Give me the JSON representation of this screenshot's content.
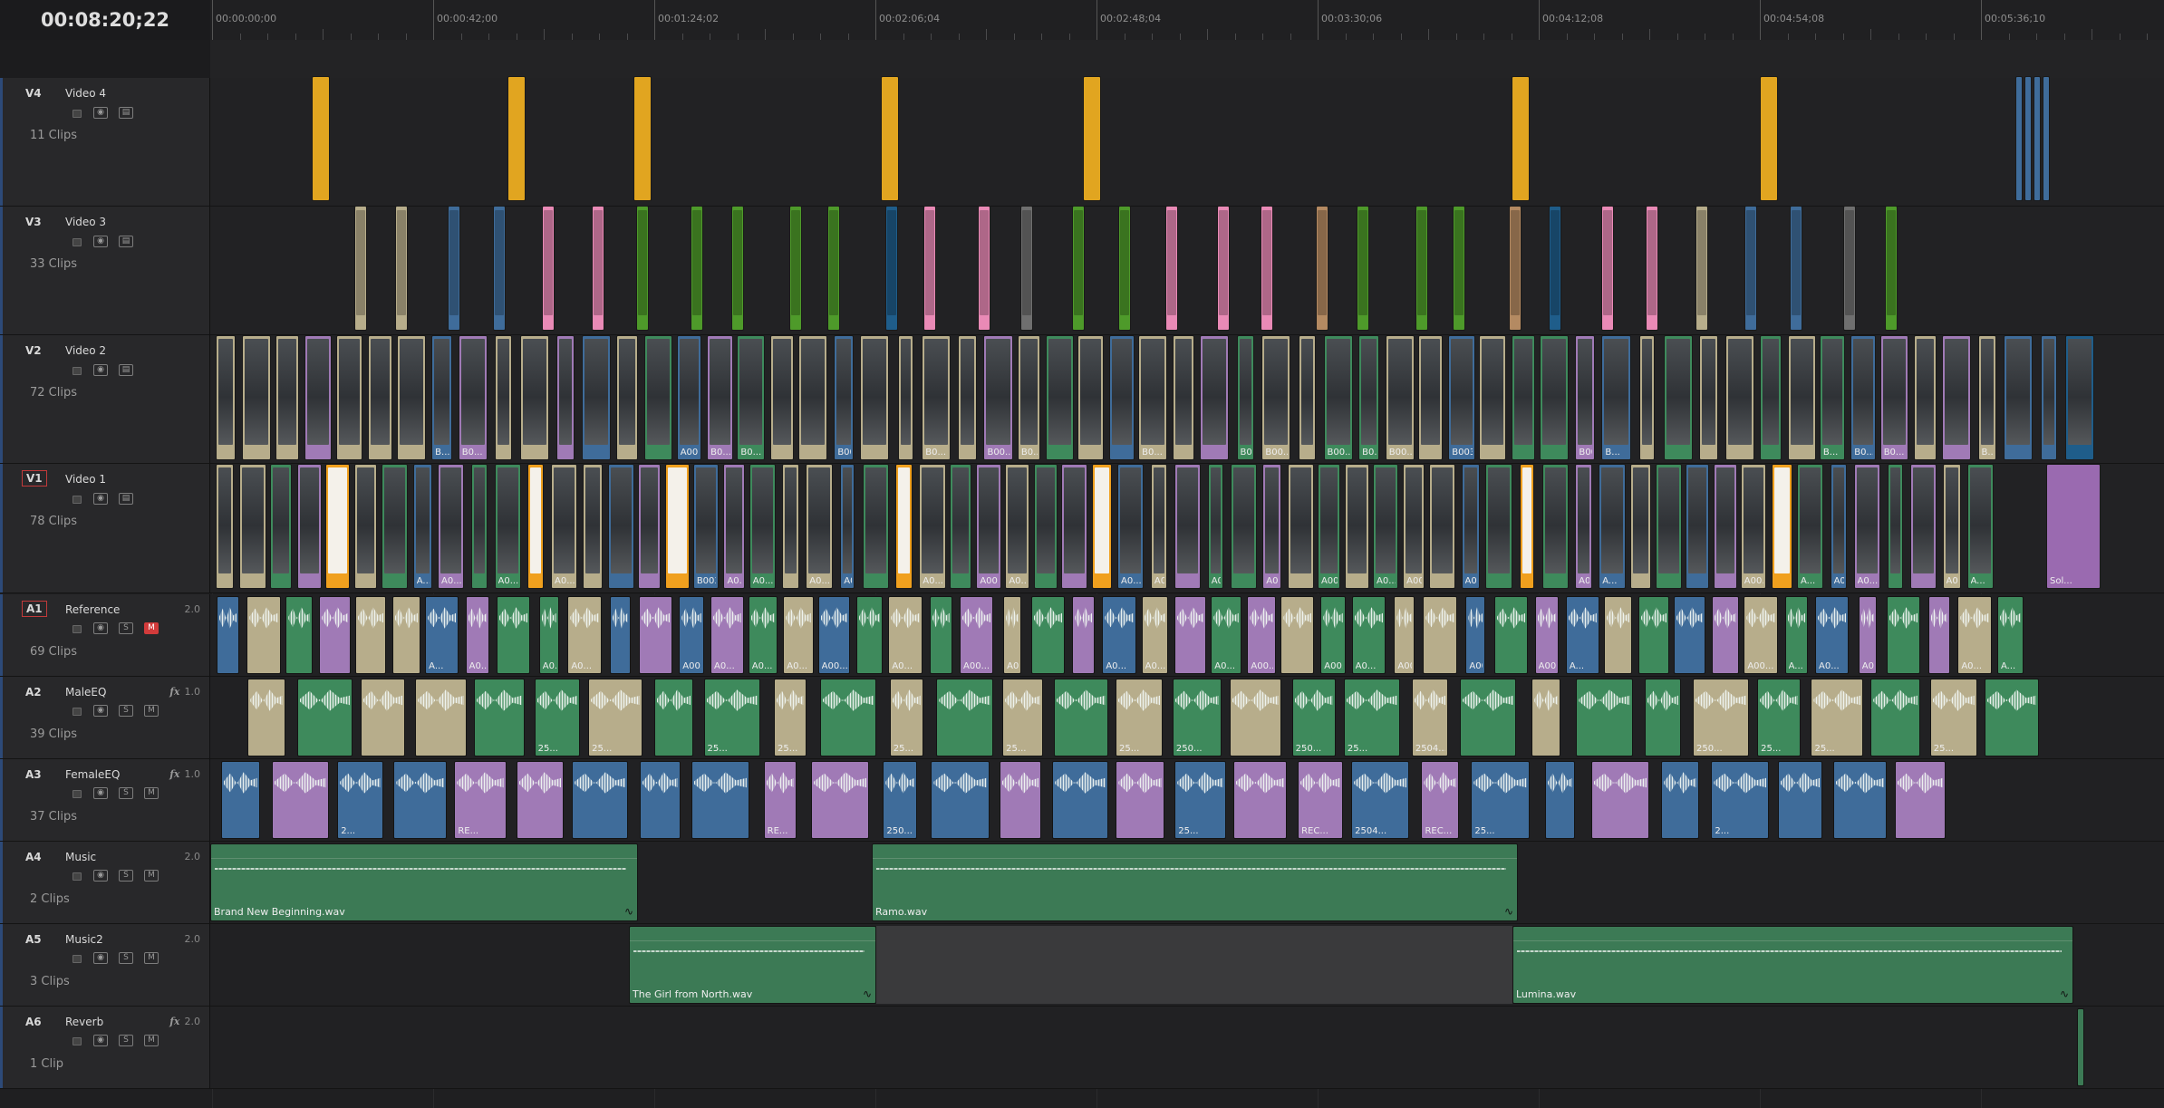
{
  "timecode": "00:08:20;22",
  "ruler": {
    "labels": [
      "00:00:00;00",
      "00:00:42;00",
      "00:01:24;02",
      "00:02:06;04",
      "00:02:48;04",
      "00:03:30;06",
      "00:04:12;08",
      "00:04:54;08",
      "00:05:36;10"
    ]
  },
  "colors": {
    "yellow": "#e1a520",
    "tan": "#b7ad8b",
    "blue": "#3f6c9a",
    "pink": "#e98ab6",
    "green": "#4e9a2a",
    "teal_green": "#3e8a5c",
    "purple": "#a07ab6",
    "orange": "#f0a01e",
    "brown": "#b48a62",
    "gray": "#6f6f6f",
    "dark_blue": "#1f5d8a",
    "music_green": "#3c7a55",
    "adj_purple": "#9a6ab0"
  },
  "tracks": {
    "v4": {
      "id": "V4",
      "name": "Video 4",
      "count": "11 Clips"
    },
    "v3": {
      "id": "V3",
      "name": "Video 3",
      "count": "33 Clips"
    },
    "v2": {
      "id": "V2",
      "name": "Video 2",
      "count": "72 Clips"
    },
    "v1": {
      "id": "V1",
      "name": "Video 1",
      "count": "78 Clips"
    },
    "a1": {
      "id": "A1",
      "name": "Reference",
      "count": "69 Clips",
      "level": "2.0",
      "solo": "S",
      "mute": "M"
    },
    "a2": {
      "id": "A2",
      "name": "MaleEQ",
      "count": "39 Clips",
      "level": "1.0",
      "fx": "fx",
      "solo": "S",
      "mute": "M"
    },
    "a3": {
      "id": "A3",
      "name": "FemaleEQ",
      "count": "37 Clips",
      "level": "1.0",
      "fx": "fx",
      "solo": "S",
      "mute": "M"
    },
    "a4": {
      "id": "A4",
      "name": "Music",
      "count": "2 Clips",
      "level": "2.0",
      "solo": "S",
      "mute": "M"
    },
    "a5": {
      "id": "A5",
      "name": "Music2",
      "count": "3 Clips",
      "level": "2.0",
      "solo": "S",
      "mute": "M"
    },
    "a6": {
      "id": "A6",
      "name": "Reverb",
      "count": "1 Clip",
      "level": "2.0",
      "fx": "fx",
      "solo": "S",
      "mute": "M"
    }
  },
  "v4_clips": [
    {
      "c": "yellow"
    },
    {
      "c": "yellow"
    },
    {
      "c": "yellow"
    },
    {
      "c": "yellow"
    },
    {
      "c": "yellow"
    },
    {
      "c": "yellow"
    },
    {
      "c": "yellow"
    },
    {
      "c": "blue"
    },
    {
      "c": "blue"
    },
    {
      "c": "blue"
    },
    {
      "c": "blue"
    }
  ],
  "v3_clips": [
    {
      "c": "tan"
    },
    {
      "c": "tan"
    },
    {
      "c": "blue"
    },
    {
      "c": "blue"
    },
    {
      "c": "pink"
    },
    {
      "c": "pink"
    },
    {
      "c": "green"
    },
    {
      "c": "green"
    },
    {
      "c": "green"
    },
    {
      "c": "green"
    },
    {
      "c": "green"
    },
    {
      "c": "dark_blue"
    },
    {
      "c": "pink"
    },
    {
      "c": "pink"
    },
    {
      "c": "gray"
    },
    {
      "c": "green"
    },
    {
      "c": "green"
    },
    {
      "c": "pink"
    },
    {
      "c": "pink"
    },
    {
      "c": "pink"
    },
    {
      "c": "brown"
    },
    {
      "c": "green"
    },
    {
      "c": "green"
    },
    {
      "c": "green"
    },
    {
      "c": "brown"
    },
    {
      "c": "dark_blue"
    },
    {
      "c": "pink"
    },
    {
      "c": "pink"
    },
    {
      "c": "tan"
    },
    {
      "c": "blue"
    },
    {
      "c": "blue"
    },
    {
      "c": "gray"
    },
    {
      "c": "green"
    }
  ],
  "v2_clips": [
    {
      "c": "tan"
    },
    {
      "c": "tan"
    },
    {
      "c": "tan"
    },
    {
      "c": "purple"
    },
    {
      "c": "tan"
    },
    {
      "c": "tan"
    },
    {
      "c": "tan"
    },
    {
      "c": "blue",
      "t": "B..."
    },
    {
      "c": "purple",
      "t": "B0..."
    },
    {
      "c": "tan"
    },
    {
      "c": "tan"
    },
    {
      "c": "purple"
    },
    {
      "c": "blue"
    },
    {
      "c": "tan"
    },
    {
      "c": "teal_green"
    },
    {
      "c": "blue",
      "t": "A00..."
    },
    {
      "c": "purple",
      "t": "B0..."
    },
    {
      "c": "teal_green",
      "t": "B0..."
    },
    {
      "c": "tan"
    },
    {
      "c": "tan"
    },
    {
      "c": "blue",
      "t": "B00..."
    },
    {
      "c": "tan"
    },
    {
      "c": "tan"
    },
    {
      "c": "tan",
      "t": "B0..."
    },
    {
      "c": "tan"
    },
    {
      "c": "purple",
      "t": "B00..."
    },
    {
      "c": "tan",
      "t": "B0..."
    },
    {
      "c": "teal_green"
    },
    {
      "c": "tan"
    },
    {
      "c": "blue"
    },
    {
      "c": "tan",
      "t": "B0..."
    },
    {
      "c": "tan"
    },
    {
      "c": "purple"
    },
    {
      "c": "teal_green",
      "t": "B0..."
    },
    {
      "c": "tan",
      "t": "B00..."
    },
    {
      "c": "tan"
    },
    {
      "c": "teal_green",
      "t": "B00..."
    },
    {
      "c": "teal_green",
      "t": "B0..."
    },
    {
      "c": "tan",
      "t": "B00..."
    },
    {
      "c": "tan"
    },
    {
      "c": "blue",
      "t": "B003..."
    },
    {
      "c": "tan"
    },
    {
      "c": "teal_green"
    },
    {
      "c": "teal_green"
    },
    {
      "c": "purple",
      "t": "B00..."
    },
    {
      "c": "blue",
      "t": "B..."
    },
    {
      "c": "tan"
    },
    {
      "c": "teal_green"
    },
    {
      "c": "tan"
    },
    {
      "c": "tan"
    },
    {
      "c": "teal_green"
    },
    {
      "c": "tan"
    },
    {
      "c": "teal_green",
      "t": "B..."
    },
    {
      "c": "blue",
      "t": "B0..."
    },
    {
      "c": "purple",
      "t": "B0..."
    },
    {
      "c": "tan"
    },
    {
      "c": "purple"
    },
    {
      "c": "tan",
      "t": "B..."
    },
    {
      "c": "blue"
    },
    {
      "c": "blue"
    },
    {
      "c": "dark_blue"
    }
  ],
  "v1_clips": [
    {
      "c": "tan"
    },
    {
      "c": "tan"
    },
    {
      "c": "teal_green"
    },
    {
      "c": "purple"
    },
    {
      "c": "orange"
    },
    {
      "c": "tan"
    },
    {
      "c": "teal_green"
    },
    {
      "c": "blue",
      "t": "A..."
    },
    {
      "c": "purple",
      "t": "A0..."
    },
    {
      "c": "teal_green"
    },
    {
      "c": "teal_green",
      "t": "A0..."
    },
    {
      "c": "orange"
    },
    {
      "c": "tan",
      "t": "A0..."
    },
    {
      "c": "tan"
    },
    {
      "c": "blue"
    },
    {
      "c": "purple"
    },
    {
      "c": "orange"
    },
    {
      "c": "blue",
      "t": "B003..."
    },
    {
      "c": "purple",
      "t": "A0..."
    },
    {
      "c": "teal_green",
      "t": "A0..."
    },
    {
      "c": "tan"
    },
    {
      "c": "tan",
      "t": "A0..."
    },
    {
      "c": "blue",
      "t": "A00..."
    },
    {
      "c": "teal_green"
    },
    {
      "c": "orange"
    },
    {
      "c": "tan",
      "t": "A0..."
    },
    {
      "c": "teal_green"
    },
    {
      "c": "purple",
      "t": "A00..."
    },
    {
      "c": "tan",
      "t": "A0..."
    },
    {
      "c": "teal_green"
    },
    {
      "c": "purple"
    },
    {
      "c": "orange"
    },
    {
      "c": "blue",
      "t": "A0..."
    },
    {
      "c": "tan",
      "t": "A0..."
    },
    {
      "c": "purple"
    },
    {
      "c": "teal_green",
      "t": "A0..."
    },
    {
      "c": "teal_green"
    },
    {
      "c": "purple",
      "t": "A00..."
    },
    {
      "c": "tan"
    },
    {
      "c": "teal_green",
      "t": "A00..."
    },
    {
      "c": "tan"
    },
    {
      "c": "teal_green",
      "t": "A0..."
    },
    {
      "c": "tan",
      "t": "A00..."
    },
    {
      "c": "tan"
    },
    {
      "c": "blue",
      "t": "A003..."
    },
    {
      "c": "teal_green"
    },
    {
      "c": "orange"
    },
    {
      "c": "teal_green"
    },
    {
      "c": "purple",
      "t": "A00..."
    },
    {
      "c": "blue",
      "t": "A..."
    },
    {
      "c": "tan"
    },
    {
      "c": "teal_green"
    },
    {
      "c": "blue"
    },
    {
      "c": "purple"
    },
    {
      "c": "tan",
      "t": "A00..."
    },
    {
      "c": "orange"
    },
    {
      "c": "teal_green",
      "t": "A..."
    },
    {
      "c": "blue",
      "t": "A0..."
    },
    {
      "c": "purple",
      "t": "A0..."
    },
    {
      "c": "teal_green"
    },
    {
      "c": "purple"
    },
    {
      "c": "tan",
      "t": "A0..."
    },
    {
      "c": "teal_green",
      "t": "A..."
    },
    {
      "c": "adj_purple",
      "t": "Sol..."
    }
  ],
  "a1_clips": [
    {
      "c": "blue"
    },
    {
      "c": "tan"
    },
    {
      "c": "teal_green"
    },
    {
      "c": "purple"
    },
    {
      "c": "tan"
    },
    {
      "c": "tan"
    },
    {
      "c": "blue",
      "t": "A..."
    },
    {
      "c": "purple",
      "t": "A0..."
    },
    {
      "c": "teal_green"
    },
    {
      "c": "teal_green",
      "t": "A0..."
    },
    {
      "c": "tan",
      "t": "A0..."
    },
    {
      "c": "blue"
    },
    {
      "c": "purple"
    },
    {
      "c": "blue",
      "t": "A00..."
    },
    {
      "c": "purple",
      "t": "A0..."
    },
    {
      "c": "teal_green",
      "t": "A0..."
    },
    {
      "c": "tan",
      "t": "A0..."
    },
    {
      "c": "blue",
      "t": "A00..."
    },
    {
      "c": "teal_green"
    },
    {
      "c": "tan",
      "t": "A0..."
    },
    {
      "c": "teal_green"
    },
    {
      "c": "purple",
      "t": "A00..."
    },
    {
      "c": "tan",
      "t": "A0..."
    },
    {
      "c": "teal_green"
    },
    {
      "c": "purple"
    },
    {
      "c": "blue",
      "t": "A0..."
    },
    {
      "c": "tan",
      "t": "A0..."
    },
    {
      "c": "purple"
    },
    {
      "c": "teal_green",
      "t": "A0..."
    },
    {
      "c": "purple",
      "t": "A00..."
    },
    {
      "c": "tan"
    },
    {
      "c": "teal_green",
      "t": "A00..."
    },
    {
      "c": "teal_green",
      "t": "A0..."
    },
    {
      "c": "tan",
      "t": "A00..."
    },
    {
      "c": "tan"
    },
    {
      "c": "blue",
      "t": "A003..."
    },
    {
      "c": "teal_green"
    },
    {
      "c": "purple",
      "t": "A00..."
    },
    {
      "c": "blue",
      "t": "A..."
    },
    {
      "c": "tan"
    },
    {
      "c": "teal_green"
    },
    {
      "c": "blue"
    },
    {
      "c": "purple"
    },
    {
      "c": "tan",
      "t": "A00..."
    },
    {
      "c": "teal_green",
      "t": "A..."
    },
    {
      "c": "blue",
      "t": "A0..."
    },
    {
      "c": "purple",
      "t": "A0..."
    },
    {
      "c": "teal_green"
    },
    {
      "c": "purple"
    },
    {
      "c": "tan",
      "t": "A0..."
    },
    {
      "c": "teal_green",
      "t": "A..."
    }
  ],
  "a2_clips": [
    {
      "c": "tan"
    },
    {
      "c": "teal_green"
    },
    {
      "c": "tan"
    },
    {
      "c": "tan"
    },
    {
      "c": "teal_green"
    },
    {
      "c": "teal_green",
      "t": "25..."
    },
    {
      "c": "tan",
      "t": "25..."
    },
    {
      "c": "teal_green"
    },
    {
      "c": "teal_green",
      "t": "25..."
    },
    {
      "c": "tan",
      "t": "25..."
    },
    {
      "c": "teal_green"
    },
    {
      "c": "tan",
      "t": "25..."
    },
    {
      "c": "teal_green"
    },
    {
      "c": "tan",
      "t": "25..."
    },
    {
      "c": "teal_green"
    },
    {
      "c": "tan",
      "t": "25..."
    },
    {
      "c": "teal_green",
      "t": "250..."
    },
    {
      "c": "tan"
    },
    {
      "c": "teal_green",
      "t": "250..."
    },
    {
      "c": "teal_green",
      "t": "25..."
    },
    {
      "c": "tan",
      "t": "2504..."
    },
    {
      "c": "teal_green"
    },
    {
      "c": "tan"
    },
    {
      "c": "teal_green"
    },
    {
      "c": "teal_green"
    },
    {
      "c": "tan",
      "t": "250..."
    },
    {
      "c": "teal_green",
      "t": "25..."
    },
    {
      "c": "tan",
      "t": "25..."
    },
    {
      "c": "teal_green"
    },
    {
      "c": "tan",
      "t": "25..."
    },
    {
      "c": "teal_green"
    }
  ],
  "a3_clips": [
    {
      "c": "blue"
    },
    {
      "c": "purple"
    },
    {
      "c": "blue",
      "t": "2..."
    },
    {
      "c": "blue"
    },
    {
      "c": "purple",
      "t": "RE..."
    },
    {
      "c": "purple"
    },
    {
      "c": "blue"
    },
    {
      "c": "blue"
    },
    {
      "c": "blue"
    },
    {
      "c": "purple",
      "t": "RE..."
    },
    {
      "c": "purple"
    },
    {
      "c": "blue",
      "t": "250..."
    },
    {
      "c": "blue"
    },
    {
      "c": "purple"
    },
    {
      "c": "blue"
    },
    {
      "c": "purple"
    },
    {
      "c": "blue",
      "t": "25..."
    },
    {
      "c": "purple"
    },
    {
      "c": "purple",
      "t": "REC..."
    },
    {
      "c": "blue",
      "t": "2504..."
    },
    {
      "c": "purple",
      "t": "REC..."
    },
    {
      "c": "blue",
      "t": "25..."
    },
    {
      "c": "blue"
    },
    {
      "c": "purple"
    },
    {
      "c": "blue"
    },
    {
      "c": "blue",
      "t": "2..."
    },
    {
      "c": "blue"
    },
    {
      "c": "blue"
    },
    {
      "c": "purple"
    }
  ],
  "music_clips": [
    {
      "track": "a4",
      "label": "Brand New Beginning.wav",
      "start": 0,
      "end": 472
    },
    {
      "track": "a4",
      "label": "Ramo.wav",
      "start": 730,
      "end": 1443
    },
    {
      "track": "a5",
      "label": "The Girl from North.wav",
      "start": 462,
      "end": 735
    },
    {
      "track": "a5",
      "label": "Lumina.wav",
      "start": 1437,
      "end": 2056
    }
  ],
  "reverb_clip": {
    "label": ""
  }
}
